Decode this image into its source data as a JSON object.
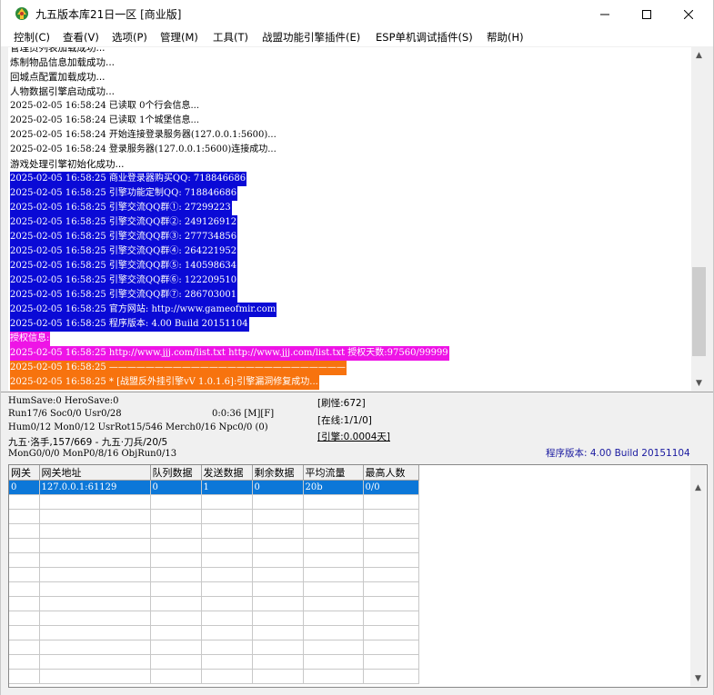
{
  "window": {
    "title": "九五版本库21日一区 [商业版]",
    "controls": {
      "minimize": "—",
      "maximize": "☐",
      "close": "✕"
    }
  },
  "menu": [
    "控制(C)",
    "查看(V)",
    "选项(P)",
    "管理(M)",
    "工具(T)",
    "战盟功能引擎插件(E)",
    "ESP单机调试插件(S)",
    "帮助(H)"
  ],
  "log": [
    {
      "text": "炼制物品信息加载成功...",
      "style": "plain"
    },
    {
      "text": "回城点配置加载成功...",
      "style": "plain"
    },
    {
      "text": "人物数据引擎启动成功...",
      "style": "plain"
    },
    {
      "text": "2025-02-05 16:58:24 已读取 0个行会信息...",
      "style": "plain"
    },
    {
      "text": "2025-02-05 16:58:24 已读取 1个城堡信息...",
      "style": "plain"
    },
    {
      "text": "2025-02-05 16:58:24 开始连接登录服务器(127.0.0.1:5600)...",
      "style": "plain"
    },
    {
      "text": "2025-02-05 16:58:24 登录服务器(127.0.0.1:5600)连接成功...",
      "style": "plain"
    },
    {
      "text": "游戏处理引擎初始化成功...",
      "style": "plain"
    },
    {
      "text": "2025-02-05 16:58:25 商业登录器购买QQ: 718846686",
      "style": "blue"
    },
    {
      "text": "2025-02-05 16:58:25 引擎功能定制QQ: 718846686",
      "style": "blue"
    },
    {
      "text": "2025-02-05 16:58:25 引擎交流QQ群①: 27299223",
      "style": "blue"
    },
    {
      "text": "2025-02-05 16:58:25 引擎交流QQ群②: 249126912",
      "style": "blue"
    },
    {
      "text": "2025-02-05 16:58:25 引擎交流QQ群③: 277734856",
      "style": "blue"
    },
    {
      "text": "2025-02-05 16:58:25 引擎交流QQ群④: 264221952",
      "style": "blue"
    },
    {
      "text": "2025-02-05 16:58:25 引擎交流QQ群⑤: 140598634",
      "style": "blue"
    },
    {
      "text": "2025-02-05 16:58:25 引擎交流QQ群⑥: 122209510",
      "style": "blue"
    },
    {
      "text": "2025-02-05 16:58:25 引擎交流QQ群⑦: 286703001",
      "style": "blue"
    },
    {
      "text": "2025-02-05 16:58:25 官方网站: http://www.gameofmir.com",
      "style": "blue"
    },
    {
      "text": "2025-02-05 16:58:25 程序版本: 4.00 Build 20151104",
      "style": "blue"
    },
    {
      "text": "授权信息:",
      "style": "magenta"
    },
    {
      "text": "2025-02-05 16:58:25 http://www.jjj.com/list.txt http://www.jjj.com/list.txt 授权天数:97560/99999",
      "style": "magenta"
    },
    {
      "text": "2025-02-05 16:58:25 ——————————————————————————",
      "style": "orange"
    },
    {
      "text": "2025-02-05 16:58:25 * [战盟反外挂引擎vV 1.0.1.6]:引擎漏洞修复成功...",
      "style": "orange"
    }
  ],
  "status": {
    "humsave": "HumSave:0 HeroSave:0",
    "run": "Run17/6 Soc0/0 Usr0/28",
    "time": "0:0:36 [M][F]",
    "shuaguai": "[刷怪:672]",
    "online": "[在线:1/1/0]",
    "engine": "[引擎:0.0004天]",
    "hum": "Hum0/12 Mon0/12 UsrRot15/546 Merch0/16 Npc0/0 (0)",
    "maps": "九五·洛手,157/669 - 九五·刀兵/20/5",
    "mong": "MonG0/0/0 MonP0/8/16 ObjRun0/13",
    "version": "程序版本: 4.00 Build 20151104"
  },
  "grid": {
    "headers": [
      "网关",
      "网关地址",
      "队列数据",
      "发送数据",
      "剩余数据",
      "平均流量",
      "最高人数"
    ],
    "rows": [
      [
        "0",
        "127.0.0.1:61129",
        "0",
        "1",
        "0",
        "20b",
        "0/0"
      ]
    ],
    "selected_row": 0
  },
  "colors": {
    "blue_highlight": "#0a0ad6",
    "magenta_highlight": "#ee14e6",
    "orange_highlight": "#f7730e",
    "selection": "#0c77d8"
  }
}
